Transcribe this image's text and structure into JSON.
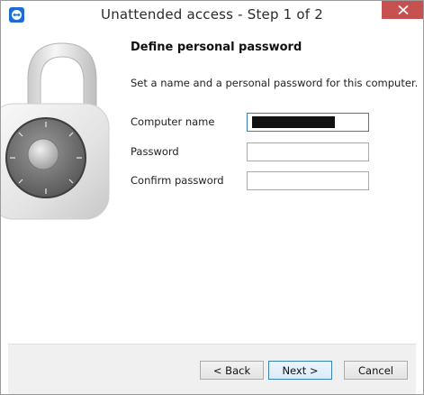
{
  "window": {
    "title": "Unattended access - Step 1 of 2",
    "close_icon": "close-icon",
    "app_icon": "teamviewer-icon",
    "accent_color": "#1d6bd3",
    "close_color": "#c75050"
  },
  "page": {
    "heading": "Define personal password",
    "description": "Set a name and a personal password for this computer."
  },
  "form": {
    "computer_name_label": "Computer name",
    "password_label": "Password",
    "confirm_password_label": "Confirm password",
    "computer_name_value": "",
    "password_value": "",
    "confirm_password_value": ""
  },
  "buttons": {
    "back": "< Back",
    "next": "Next >",
    "cancel": "Cancel"
  }
}
